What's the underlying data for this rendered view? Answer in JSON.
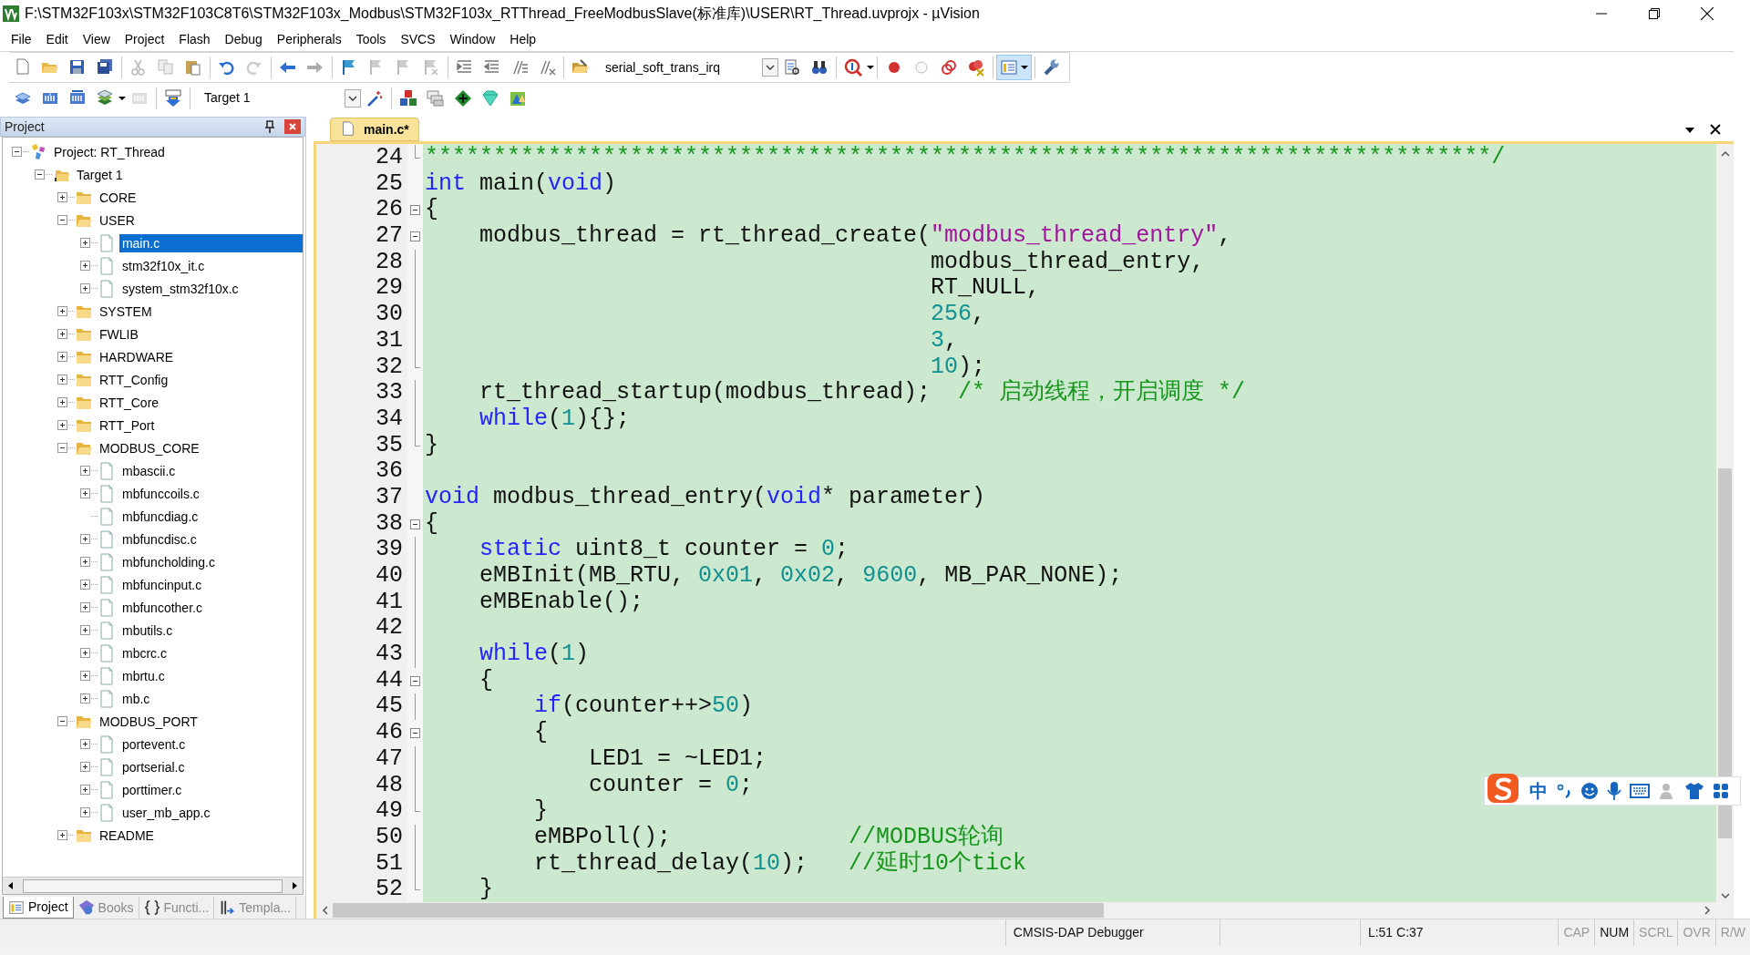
{
  "window": {
    "title": "F:\\STM32F103x\\STM32F103C8T6\\STM32F103x_Modbus\\STM32F103x_RTThread_FreeModbusSlave(标准库)\\USER\\RT_Thread.uvprojx - µVision"
  },
  "menu": [
    "File",
    "Edit",
    "View",
    "Project",
    "Flash",
    "Debug",
    "Peripherals",
    "Tools",
    "SVCS",
    "Window",
    "Help"
  ],
  "toolbar": {
    "find_combo": "serial_soft_trans_irq",
    "target_combo": "Target 1",
    "layout_button_on": true
  },
  "project_panel": {
    "title": "Project",
    "tree": [
      {
        "label": "Project: RT_Thread",
        "kind": "project",
        "expandable": true,
        "expanded": true,
        "selected": false,
        "children": [
          {
            "label": "Target 1",
            "kind": "target",
            "expandable": true,
            "expanded": true,
            "selected": false,
            "children": [
              {
                "label": "CORE",
                "kind": "folder",
                "expandable": true,
                "expanded": false,
                "selected": false
              },
              {
                "label": "USER",
                "kind": "folder",
                "expandable": true,
                "expanded": true,
                "selected": false,
                "children": [
                  {
                    "label": "main.c",
                    "kind": "file",
                    "expandable": true,
                    "expanded": false,
                    "selected": true
                  },
                  {
                    "label": "stm32f10x_it.c",
                    "kind": "file",
                    "expandable": true,
                    "expanded": false,
                    "selected": false
                  },
                  {
                    "label": "system_stm32f10x.c",
                    "kind": "file",
                    "expandable": true,
                    "expanded": false,
                    "selected": false
                  }
                ]
              },
              {
                "label": "SYSTEM",
                "kind": "folder",
                "expandable": true,
                "expanded": false,
                "selected": false
              },
              {
                "label": "FWLIB",
                "kind": "folder",
                "expandable": true,
                "expanded": false,
                "selected": false
              },
              {
                "label": "HARDWARE",
                "kind": "folder",
                "expandable": true,
                "expanded": false,
                "selected": false
              },
              {
                "label": "RTT_Config",
                "kind": "folder",
                "expandable": true,
                "expanded": false,
                "selected": false
              },
              {
                "label": "RTT_Core",
                "kind": "folder",
                "expandable": true,
                "expanded": false,
                "selected": false
              },
              {
                "label": "RTT_Port",
                "kind": "folder",
                "expandable": true,
                "expanded": false,
                "selected": false
              },
              {
                "label": "MODBUS_CORE",
                "kind": "folder",
                "expandable": true,
                "expanded": true,
                "selected": false,
                "children": [
                  {
                    "label": "mbascii.c",
                    "kind": "file",
                    "expandable": true,
                    "expanded": false,
                    "selected": false
                  },
                  {
                    "label": "mbfunccoils.c",
                    "kind": "file",
                    "expandable": true,
                    "expanded": false,
                    "selected": false
                  },
                  {
                    "label": "mbfuncdiag.c",
                    "kind": "file",
                    "expandable": false,
                    "selected": false
                  },
                  {
                    "label": "mbfuncdisc.c",
                    "kind": "file",
                    "expandable": true,
                    "expanded": false,
                    "selected": false
                  },
                  {
                    "label": "mbfuncholding.c",
                    "kind": "file",
                    "expandable": true,
                    "expanded": false,
                    "selected": false
                  },
                  {
                    "label": "mbfuncinput.c",
                    "kind": "file",
                    "expandable": true,
                    "expanded": false,
                    "selected": false
                  },
                  {
                    "label": "mbfuncother.c",
                    "kind": "file",
                    "expandable": true,
                    "expanded": false,
                    "selected": false
                  },
                  {
                    "label": "mbutils.c",
                    "kind": "file",
                    "expandable": true,
                    "expanded": false,
                    "selected": false
                  },
                  {
                    "label": "mbcrc.c",
                    "kind": "file",
                    "expandable": true,
                    "expanded": false,
                    "selected": false
                  },
                  {
                    "label": "mbrtu.c",
                    "kind": "file",
                    "expandable": true,
                    "expanded": false,
                    "selected": false
                  },
                  {
                    "label": "mb.c",
                    "kind": "file",
                    "expandable": true,
                    "expanded": false,
                    "selected": false
                  }
                ]
              },
              {
                "label": "MODBUS_PORT",
                "kind": "folder",
                "expandable": true,
                "expanded": true,
                "selected": false,
                "children": [
                  {
                    "label": "portevent.c",
                    "kind": "file",
                    "expandable": true,
                    "expanded": false,
                    "selected": false
                  },
                  {
                    "label": "portserial.c",
                    "kind": "file",
                    "expandable": true,
                    "expanded": false,
                    "selected": false
                  },
                  {
                    "label": "porttimer.c",
                    "kind": "file",
                    "expandable": true,
                    "expanded": false,
                    "selected": false
                  },
                  {
                    "label": "user_mb_app.c",
                    "kind": "file",
                    "expandable": true,
                    "expanded": false,
                    "selected": false
                  }
                ]
              },
              {
                "label": "README",
                "kind": "folder",
                "expandable": true,
                "expanded": false,
                "selected": false
              }
            ]
          }
        ]
      }
    ],
    "tabs": [
      {
        "label": "Project",
        "kind": "project",
        "selected": true
      },
      {
        "label": "Books",
        "kind": "books",
        "selected": false
      },
      {
        "label": "Functi...",
        "kind": "functions",
        "selected": false
      },
      {
        "label": "Templa...",
        "kind": "templates",
        "selected": false
      }
    ]
  },
  "editor": {
    "tabs": [
      {
        "label": "main.c*",
        "selected": true
      }
    ],
    "lines": [
      {
        "number": "24",
        "kind": "end",
        "tokens": [
          {
            "kind": "comment",
            "text": "******************************************************************************/"
          }
        ]
      },
      {
        "number": "25",
        "kind": "plain",
        "tokens": [
          {
            "kind": "keyword",
            "text": "int"
          },
          {
            "kind": "plain",
            "text": " main("
          },
          {
            "kind": "keyword",
            "text": "void"
          },
          {
            "kind": "plain",
            "text": ")"
          }
        ]
      },
      {
        "number": "26",
        "kind": "start",
        "tokens": [
          {
            "kind": "plain",
            "text": "{"
          }
        ]
      },
      {
        "number": "27",
        "kind": "start",
        "tokens": [
          {
            "kind": "plain",
            "text": "    modbus_thread = rt_thread_create("
          },
          {
            "kind": "string",
            "text": "\"modbus_thread_entry\""
          },
          {
            "kind": "plain",
            "text": ","
          }
        ]
      },
      {
        "number": "28",
        "kind": "block",
        "tokens": [
          {
            "kind": "plain",
            "text": "                                     modbus_thread_entry,"
          }
        ]
      },
      {
        "number": "29",
        "kind": "block",
        "tokens": [
          {
            "kind": "plain",
            "text": "                                     RT_NULL,"
          }
        ]
      },
      {
        "number": "30",
        "kind": "block",
        "tokens": [
          {
            "kind": "number",
            "text": "                                     256"
          },
          {
            "kind": "plain",
            "text": ","
          }
        ]
      },
      {
        "number": "31",
        "kind": "block",
        "tokens": [
          {
            "kind": "number",
            "text": "                                     3"
          },
          {
            "kind": "plain",
            "text": ","
          }
        ]
      },
      {
        "number": "32",
        "kind": "end",
        "tokens": [
          {
            "kind": "number",
            "text": "                                     10"
          },
          {
            "kind": "plain",
            "text": ");"
          }
        ]
      },
      {
        "number": "33",
        "kind": "block",
        "tokens": [
          {
            "kind": "plain",
            "text": "    rt_thread_startup(modbus_thread);  "
          },
          {
            "kind": "comment",
            "text": "/* 启动线程，开启调度 */"
          }
        ]
      },
      {
        "number": "34",
        "kind": "block",
        "tokens": [
          {
            "kind": "keyword",
            "text": "    while"
          },
          {
            "kind": "plain",
            "text": "("
          },
          {
            "kind": "number",
            "text": "1"
          },
          {
            "kind": "plain",
            "text": "){};"
          }
        ]
      },
      {
        "number": "35",
        "kind": "end",
        "tokens": [
          {
            "kind": "plain",
            "text": "}"
          }
        ]
      },
      {
        "number": "36",
        "kind": "plain"
      },
      {
        "number": "37",
        "kind": "plain",
        "tokens": [
          {
            "kind": "keyword",
            "text": "void"
          },
          {
            "kind": "plain",
            "text": " modbus_thread_entry("
          },
          {
            "kind": "keyword",
            "text": "void"
          },
          {
            "kind": "plain",
            "text": "* parameter)"
          }
        ]
      },
      {
        "number": "38",
        "kind": "start",
        "tokens": [
          {
            "kind": "plain",
            "text": "{"
          }
        ]
      },
      {
        "number": "39",
        "kind": "block",
        "tokens": [
          {
            "kind": "keyword",
            "text": "    static"
          },
          {
            "kind": "plain",
            "text": " uint8_t counter = "
          },
          {
            "kind": "number",
            "text": "0"
          },
          {
            "kind": "plain",
            "text": ";"
          }
        ]
      },
      {
        "number": "40",
        "kind": "block",
        "tokens": [
          {
            "kind": "plain",
            "text": "    eMBInit(MB_RTU, "
          },
          {
            "kind": "number",
            "text": "0x01"
          },
          {
            "kind": "plain",
            "text": ", "
          },
          {
            "kind": "number",
            "text": "0x02"
          },
          {
            "kind": "plain",
            "text": ", "
          },
          {
            "kind": "number",
            "text": "9600"
          },
          {
            "kind": "plain",
            "text": ", MB_PAR_NONE);"
          }
        ]
      },
      {
        "number": "41",
        "kind": "block",
        "tokens": [
          {
            "kind": "plain",
            "text": "    eMBEnable();"
          }
        ]
      },
      {
        "number": "42",
        "kind": "block"
      },
      {
        "number": "43",
        "kind": "block",
        "tokens": [
          {
            "kind": "keyword",
            "text": "    while"
          },
          {
            "kind": "plain",
            "text": "("
          },
          {
            "kind": "number",
            "text": "1"
          },
          {
            "kind": "plain",
            "text": ")"
          }
        ]
      },
      {
        "number": "44",
        "kind": "start",
        "tokens": [
          {
            "kind": "plain",
            "text": "    {"
          }
        ]
      },
      {
        "number": "45",
        "kind": "block",
        "tokens": [
          {
            "kind": "keyword",
            "text": "        if"
          },
          {
            "kind": "plain",
            "text": "(counter++>"
          },
          {
            "kind": "number",
            "text": "50"
          },
          {
            "kind": "plain",
            "text": ")"
          }
        ]
      },
      {
        "number": "46",
        "kind": "start",
        "tokens": [
          {
            "kind": "plain",
            "text": "        {"
          }
        ]
      },
      {
        "number": "47",
        "kind": "block",
        "tokens": [
          {
            "kind": "plain",
            "text": "            LED1 = ~LED1;"
          }
        ]
      },
      {
        "number": "48",
        "kind": "block",
        "tokens": [
          {
            "kind": "plain",
            "text": "            counter = "
          },
          {
            "kind": "number",
            "text": "0"
          },
          {
            "kind": "plain",
            "text": ";"
          }
        ]
      },
      {
        "number": "49",
        "kind": "end",
        "tokens": [
          {
            "kind": "plain",
            "text": "        }"
          }
        ]
      },
      {
        "number": "50",
        "kind": "block",
        "tokens": [
          {
            "kind": "plain",
            "text": "        eMBPoll();             "
          },
          {
            "kind": "comment",
            "text": "//MODBUS轮询"
          }
        ]
      },
      {
        "number": "51",
        "kind": "block",
        "tokens": [
          {
            "kind": "plain",
            "text": "        rt_thread_delay("
          },
          {
            "kind": "number",
            "text": "10"
          },
          {
            "kind": "plain",
            "text": ");   "
          },
          {
            "kind": "comment",
            "text": "//延时10个tick"
          }
        ]
      },
      {
        "number": "52",
        "kind": "end",
        "tokens": [
          {
            "kind": "plain",
            "text": "    }"
          }
        ]
      }
    ]
  },
  "ime_bar": {
    "mode": "中"
  },
  "status_bar": {
    "debugger": "CMSIS-DAP Debugger",
    "position": "L:51 C:37",
    "indicators": [
      {
        "label": "CAP",
        "on": false
      },
      {
        "label": "NUM",
        "on": true
      },
      {
        "label": "SCRL",
        "on": false
      },
      {
        "label": "OVR",
        "on": false
      },
      {
        "label": "R/W",
        "on": false
      }
    ]
  }
}
